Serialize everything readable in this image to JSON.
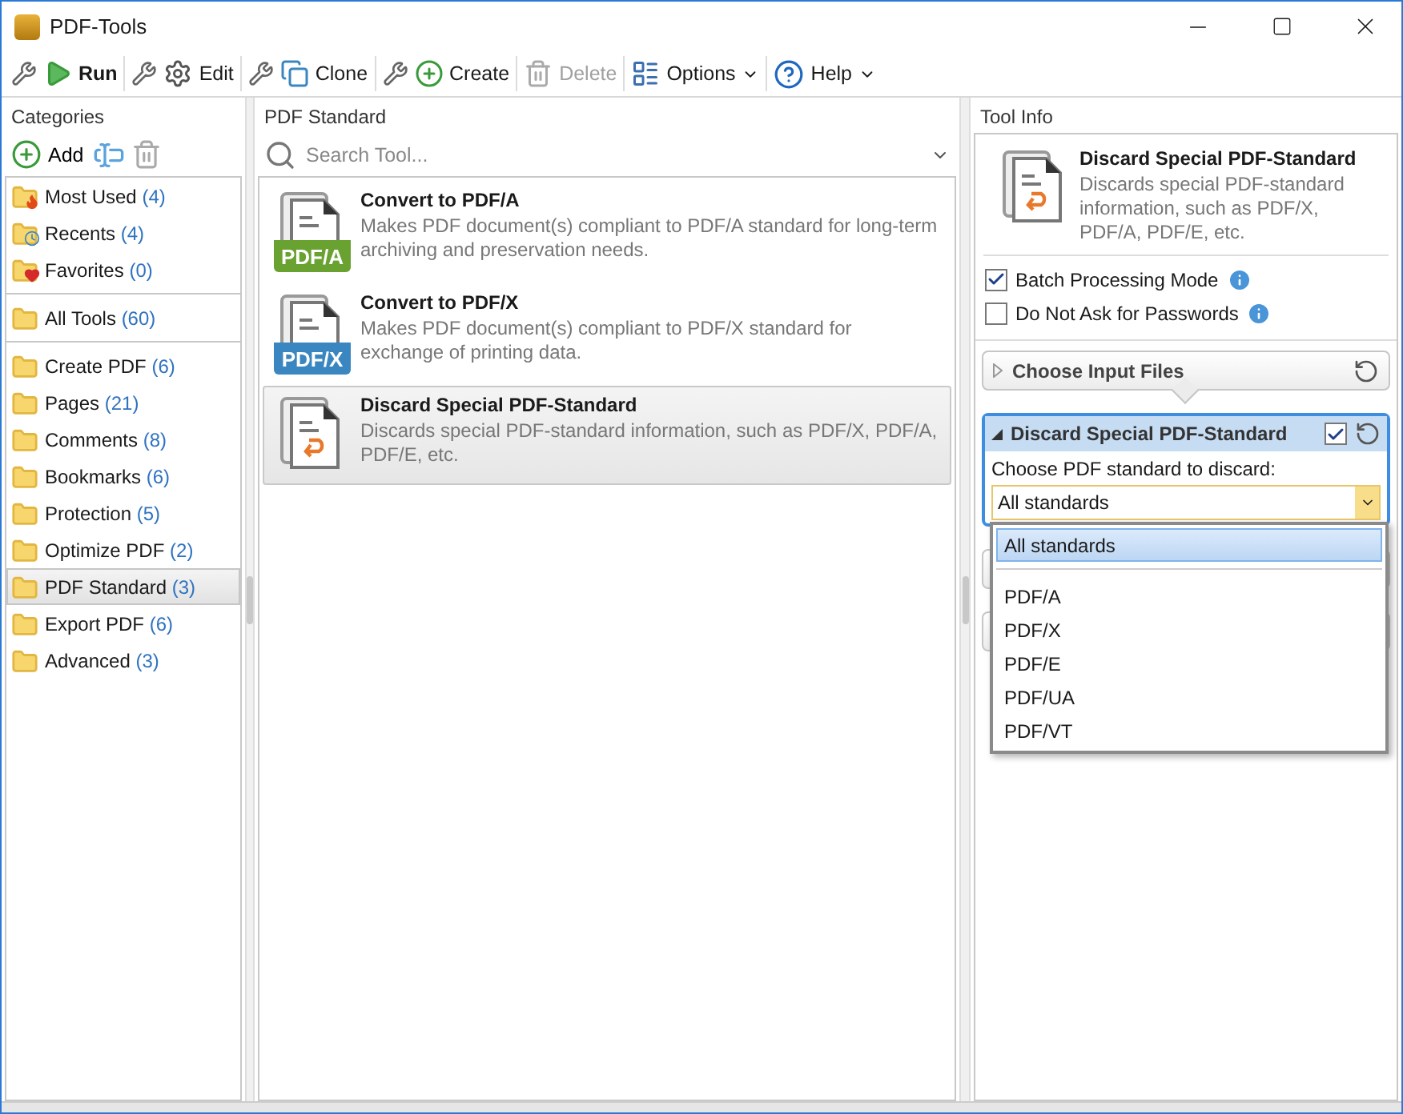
{
  "window": {
    "title": "PDF-Tools"
  },
  "toolbar": [
    {
      "label": "Run",
      "kind": "run",
      "disabled": false,
      "dropdown": false
    },
    {
      "label": "Edit",
      "kind": "edit",
      "disabled": false,
      "dropdown": false
    },
    {
      "label": "Clone",
      "kind": "clone",
      "disabled": false,
      "dropdown": false
    },
    {
      "label": "Create",
      "kind": "create",
      "disabled": false,
      "dropdown": false
    },
    {
      "label": "Delete",
      "kind": "delete",
      "disabled": true,
      "dropdown": false
    },
    {
      "label": "Options",
      "kind": "options",
      "disabled": false,
      "dropdown": true
    },
    {
      "label": "Help",
      "kind": "help",
      "disabled": false,
      "dropdown": true
    }
  ],
  "categories": {
    "title": "Categories",
    "add_label": "Add",
    "groups": [
      [
        {
          "label": "Most Used",
          "count": "(4)",
          "kind": "fire",
          "selected": false
        },
        {
          "label": "Recents",
          "count": "(4)",
          "kind": "clock",
          "selected": false
        },
        {
          "label": "Favorites",
          "count": "(0)",
          "kind": "heart",
          "selected": false
        }
      ],
      [
        {
          "label": "All Tools",
          "count": "(60)",
          "kind": "plain",
          "selected": false
        }
      ],
      [
        {
          "label": "Create PDF",
          "count": "(6)",
          "kind": "plain",
          "selected": false
        },
        {
          "label": "Pages",
          "count": "(21)",
          "kind": "plain",
          "selected": false
        },
        {
          "label": "Comments",
          "count": "(8)",
          "kind": "plain",
          "selected": false
        },
        {
          "label": "Bookmarks",
          "count": "(6)",
          "kind": "plain",
          "selected": false
        },
        {
          "label": "Protection",
          "count": "(5)",
          "kind": "plain",
          "selected": false
        },
        {
          "label": "Optimize PDF",
          "count": "(2)",
          "kind": "plain",
          "selected": false
        },
        {
          "label": "PDF Standard",
          "count": "(3)",
          "kind": "plain",
          "selected": true
        },
        {
          "label": "Export PDF",
          "count": "(6)",
          "kind": "plain",
          "selected": false
        },
        {
          "label": "Advanced",
          "count": "(3)",
          "kind": "plain",
          "selected": false
        }
      ]
    ]
  },
  "tools": {
    "title": "PDF Standard",
    "search_placeholder": "Search Tool...",
    "items": [
      {
        "title": "Convert to PDF/A",
        "description": "Makes PDF document(s) compliant to PDF/A standard for long-term archiving and preservation needs.",
        "kind": "badge",
        "badge": "PDF/A",
        "color": "#6aa232",
        "selected": false
      },
      {
        "title": "Convert to PDF/X",
        "description": "Makes PDF document(s) compliant to PDF/X standard for exchange of printing data.",
        "kind": "badge",
        "badge": "PDF/X",
        "color": "#3a86c0",
        "selected": false
      },
      {
        "title": "Discard Special PDF-Standard",
        "description": "Discards special PDF-standard information, such as PDF/X, PDF/A, PDF/E, etc.",
        "kind": "undo",
        "selected": true
      }
    ]
  },
  "tool_info": {
    "title": "Tool Info",
    "name": "Discard Special PDF-Standard",
    "description": "Discards special PDF-standard information, such as PDF/X, PDF/A, PDF/E, etc.",
    "options": [
      {
        "label": "Batch Processing Mode",
        "checked": true
      },
      {
        "label": "Do Not Ask for Passwords",
        "checked": false
      }
    ],
    "sections": [
      {
        "title": "Choose Input Files",
        "expanded": false
      },
      {
        "title": "Discard Special PDF-Standard",
        "expanded": true,
        "enabled": true,
        "field_label": "Choose PDF standard to discard:",
        "value": "All standards"
      }
    ],
    "dropdown": {
      "options": [
        {
          "label": "All standards",
          "kind": "default",
          "selected": true
        },
        {
          "label": "PDF/A",
          "kind": "standard",
          "selected": false
        },
        {
          "label": "PDF/X",
          "kind": "standard",
          "selected": false
        },
        {
          "label": "PDF/E",
          "kind": "standard",
          "selected": false
        },
        {
          "label": "PDF/UA",
          "kind": "standard",
          "selected": false
        },
        {
          "label": "PDF/VT",
          "kind": "standard",
          "selected": false
        }
      ]
    }
  }
}
